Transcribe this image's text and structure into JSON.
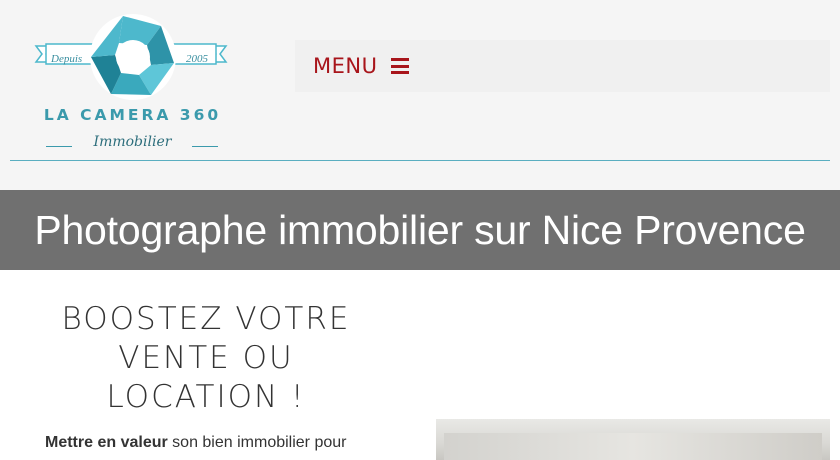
{
  "logo": {
    "ribbon_left": "Depuis",
    "ribbon_right": "2005",
    "brand": "LA CAMERA 360",
    "subtitle": "Immobilier",
    "colors": {
      "teal": "#4db8cc",
      "dark_teal": "#2d6e7c"
    }
  },
  "nav": {
    "menu_label": "MENU",
    "menu_icon": "hamburger-icon",
    "accent": "#a8151b"
  },
  "banner": {
    "title": "Photographe immobilier sur Nice Provence",
    "background": "#707070"
  },
  "content": {
    "heading_lines": [
      "BOOSTEZ VOTRE",
      "VENTE OU",
      "LOCATION !"
    ],
    "intro_bold": "Mettre en valeur",
    "intro_rest": " son bien immobilier pour"
  }
}
